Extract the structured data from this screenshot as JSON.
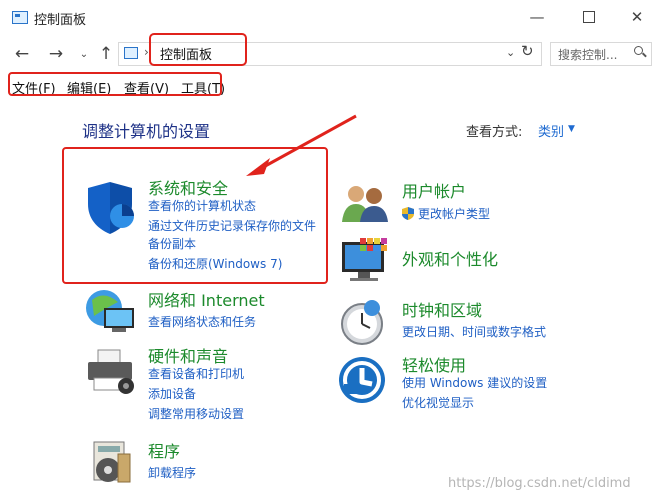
{
  "window": {
    "title": "控制面板",
    "minimize_icon": "minimize-icon",
    "maximize_icon": "maximize-icon",
    "close_icon": "close-icon"
  },
  "nav": {
    "back_icon": "back-arrow-icon",
    "forward_icon": "forward-arrow-icon",
    "recent_icon": "chevron-down-icon",
    "up_icon": "up-arrow-icon",
    "address_text": "控制面板",
    "address_sep": "›",
    "search_placeholder": "搜索控制...",
    "refresh_icon": "refresh-icon"
  },
  "menu": {
    "file": "文件(F)",
    "edit": "编辑(E)",
    "view": "查看(V)",
    "tools": "工具(T)"
  },
  "main": {
    "heading": "调整计算机的设置",
    "view_by_label": "查看方式:",
    "view_by_value": "类别",
    "categories_left": [
      {
        "title": "系统和安全",
        "icon": "shield-icon",
        "links": [
          "查看你的计算机状态",
          "通过文件历史记录保存你的文件备份副本",
          "备份和还原(Windows 7)"
        ]
      },
      {
        "title": "网络和 Internet",
        "icon": "network-icon",
        "links": [
          "查看网络状态和任务"
        ]
      },
      {
        "title": "硬件和声音",
        "icon": "printer-icon",
        "links": [
          "查看设备和打印机",
          "添加设备",
          "调整常用移动设置"
        ]
      },
      {
        "title": "程序",
        "icon": "programs-icon",
        "links": [
          "卸载程序"
        ]
      }
    ],
    "categories_right": [
      {
        "title": "用户帐户",
        "icon": "users-icon",
        "links": [
          "更改帐户类型"
        ]
      },
      {
        "title": "外观和个性化",
        "icon": "appearance-icon",
        "links": []
      },
      {
        "title": "时钟和区域",
        "icon": "clock-icon",
        "links": [
          "更改日期、时间或数字格式"
        ]
      },
      {
        "title": "轻松使用",
        "icon": "ease-of-access-icon",
        "links": [
          "使用 Windows 建议的设置",
          "优化视觉显示"
        ]
      }
    ]
  },
  "watermark": "https://blog.csdn.net/cldimd",
  "colors": {
    "accent_link": "#1f5fc4",
    "category_title": "#1c8a2c",
    "heading": "#1e3287",
    "annotation_red": "#e0231c"
  }
}
